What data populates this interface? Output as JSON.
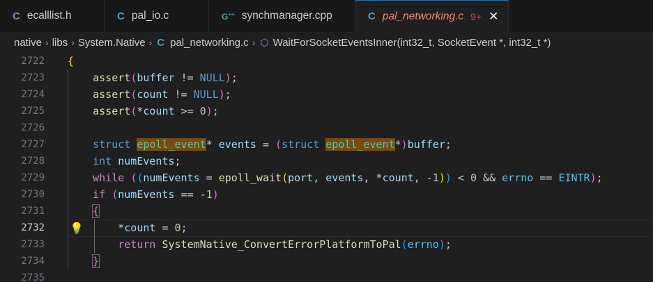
{
  "tabs": [
    {
      "label": "ecalllist.h",
      "icon": "C",
      "icon_color": "#a074c4"
    },
    {
      "label": "pal_io.c",
      "icon": "C",
      "icon_color": "#519aba"
    },
    {
      "label": "synchmanager.cpp",
      "icon": "C++",
      "icon_color": "#519aba"
    },
    {
      "label": "pal_networking.c",
      "icon": "C",
      "icon_color": "#519aba",
      "modified": "9+",
      "active": true
    }
  ],
  "breadcrumb": {
    "items": [
      "native",
      "libs",
      "System.Native",
      "pal_networking.c",
      "WaitForSocketEventsInner(int32_t, SocketEvent *, int32_t *)"
    ]
  },
  "editor": {
    "line_numbers": [
      "2722",
      "2723",
      "2724",
      "2725",
      "2726",
      "2727",
      "2728",
      "2729",
      "2730",
      "2731",
      "2732",
      "2733",
      "2734",
      "2735"
    ],
    "current_line": "2732",
    "lines": [
      "{",
      "    assert(buffer != NULL);",
      "    assert(count != NULL);",
      "    assert(*count >= 0);",
      "",
      "    struct epoll_event* events = (struct epoll_event*)buffer;",
      "    int numEvents;",
      "    while ((numEvents = epoll_wait(port, events, *count, -1)) < 0 && errno == EINTR);",
      "    if (numEvents == -1)",
      "    {",
      "        *count = 0;",
      "        return SystemNative_ConvertErrorPlatformToPal(errno);",
      "    }",
      ""
    ]
  }
}
